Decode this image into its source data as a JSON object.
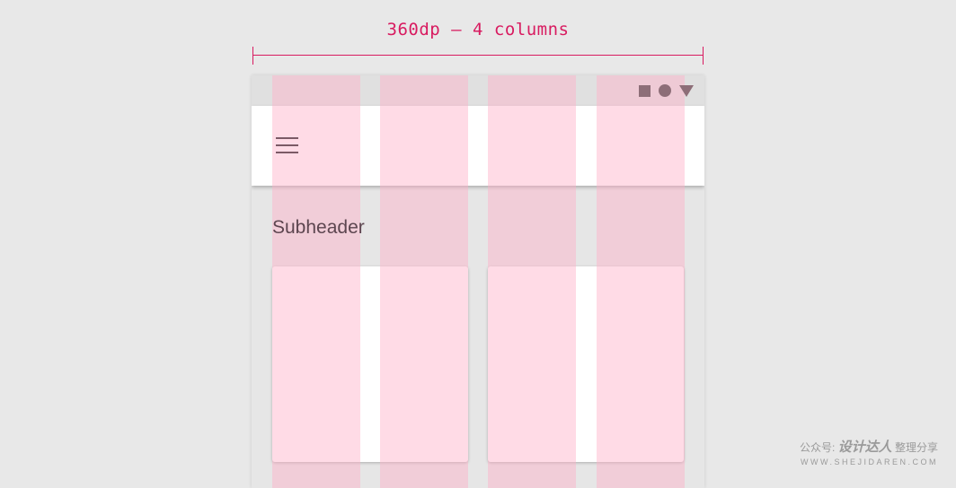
{
  "annotation": {
    "label": "360dp – 4 columns"
  },
  "grid": {
    "column_count": 4,
    "overlay_color": "#ffafc8"
  },
  "status_bar": {
    "icons": [
      "square-icon",
      "circle-icon",
      "triangle-icon"
    ]
  },
  "app_bar": {
    "nav_icon": "menu-icon"
  },
  "content": {
    "subheader": "Subheader"
  },
  "watermark": {
    "brand_prefix": "公众号:",
    "brand_name": "设计达人",
    "brand_suffix": "整理分享",
    "site": "WWW.SHEJIDAREN.COM"
  },
  "colors": {
    "accent": "#d81b60",
    "background": "#e8e8e8",
    "surface": "#ffffff",
    "icon": "#8d6e78"
  }
}
